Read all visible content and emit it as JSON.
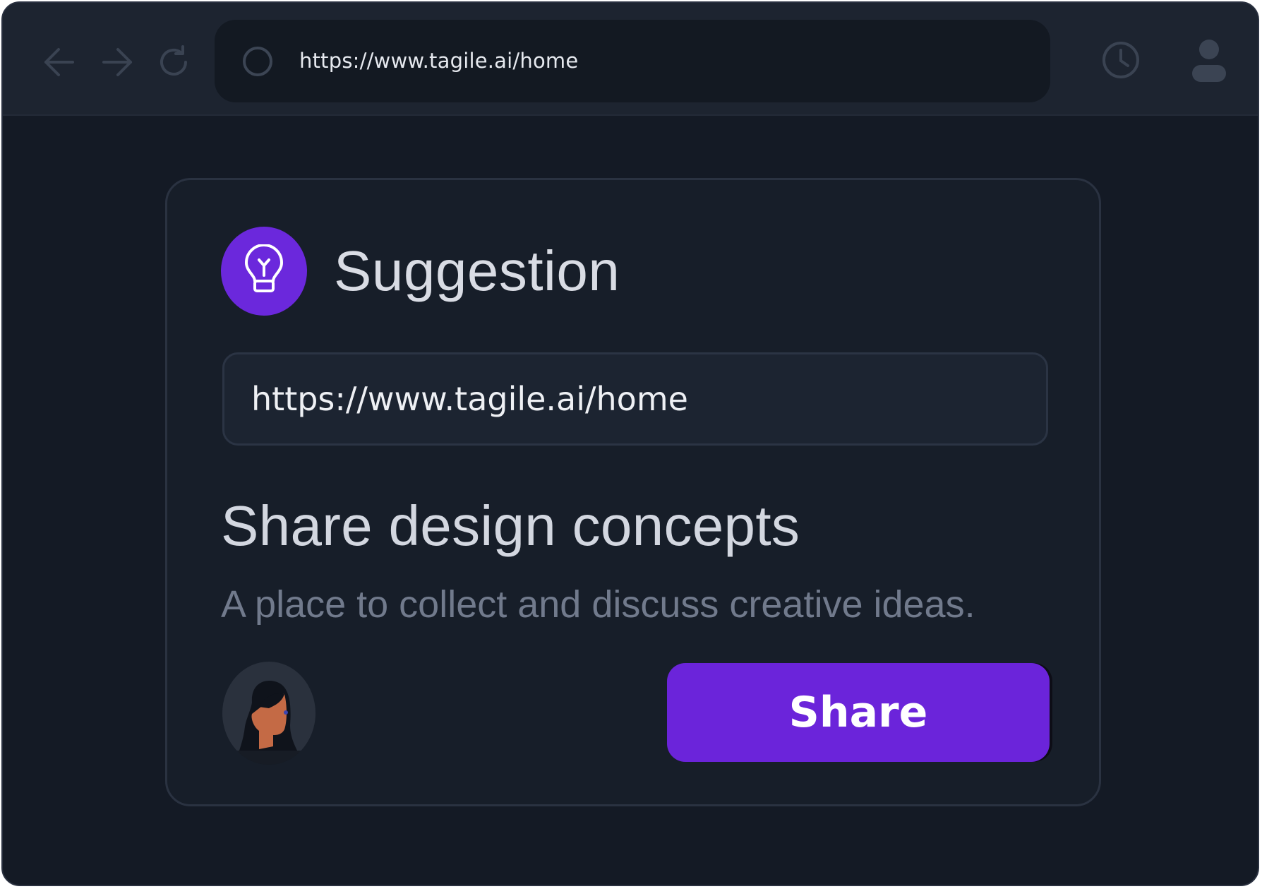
{
  "browser": {
    "address": "https://www.tagile.ai/home",
    "icons": {
      "back": "arrow-left-icon",
      "forward": "arrow-right-icon",
      "reload": "reload-icon",
      "site": "circle-icon",
      "history": "clock-icon",
      "profile": "user-icon"
    }
  },
  "card": {
    "icon": "lightbulb-icon",
    "title": "Suggestion",
    "url_value": "https://www.tagile.ai/home",
    "heading": "Share design concepts",
    "description": "A place to collect and discuss creative ideas.",
    "share_label": "Share"
  },
  "colors": {
    "accent": "#6b24da",
    "background": "#141a25",
    "card": "#171e29"
  }
}
